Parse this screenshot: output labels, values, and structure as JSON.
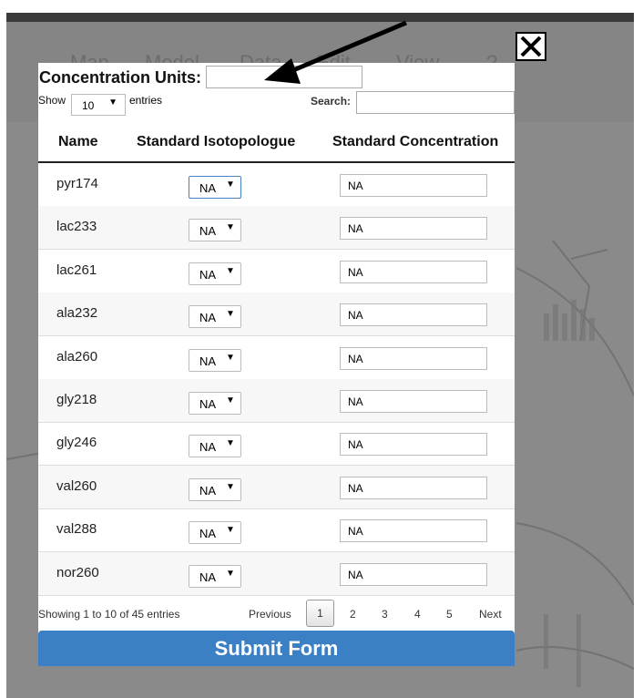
{
  "background_menu": [
    "Map",
    "Model",
    "Data",
    "Edit",
    "View",
    "?"
  ],
  "modal": {
    "units_label": "Concentration Units:",
    "units_value": "",
    "show_label": "Show",
    "page_length": "10",
    "entries_label": "entries",
    "search_label": "Search:",
    "search_value": ""
  },
  "table": {
    "headers": [
      "Name",
      "Standard Isotopologue",
      "Standard Concentration"
    ],
    "rows": [
      {
        "name": "pyr174",
        "isotopologue": "NA",
        "concentration": "NA"
      },
      {
        "name": "lac233",
        "isotopologue": "NA",
        "concentration": "NA"
      },
      {
        "name": "lac261",
        "isotopologue": "NA",
        "concentration": "NA"
      },
      {
        "name": "ala232",
        "isotopologue": "NA",
        "concentration": "NA"
      },
      {
        "name": "ala260",
        "isotopologue": "NA",
        "concentration": "NA"
      },
      {
        "name": "gly218",
        "isotopologue": "NA",
        "concentration": "NA"
      },
      {
        "name": "gly246",
        "isotopologue": "NA",
        "concentration": "NA"
      },
      {
        "name": "val260",
        "isotopologue": "NA",
        "concentration": "NA"
      },
      {
        "name": "val288",
        "isotopologue": "NA",
        "concentration": "NA"
      },
      {
        "name": "nor260",
        "isotopologue": "NA",
        "concentration": "NA"
      }
    ]
  },
  "pagination": {
    "info": "Showing 1 to 10 of 45 entries",
    "previous": "Previous",
    "pages": [
      "1",
      "2",
      "3",
      "4",
      "5"
    ],
    "current": "1",
    "next": "Next"
  },
  "submit_label": "Submit Form",
  "colors": {
    "submit": "#3b7fc4",
    "overlay": "#8a8a8a",
    "focus_border": "#4a7fc4"
  },
  "icons": {
    "close": "close-icon",
    "annotation_arrow": "arrow-icon",
    "dropdown": "caret-down-icon"
  }
}
